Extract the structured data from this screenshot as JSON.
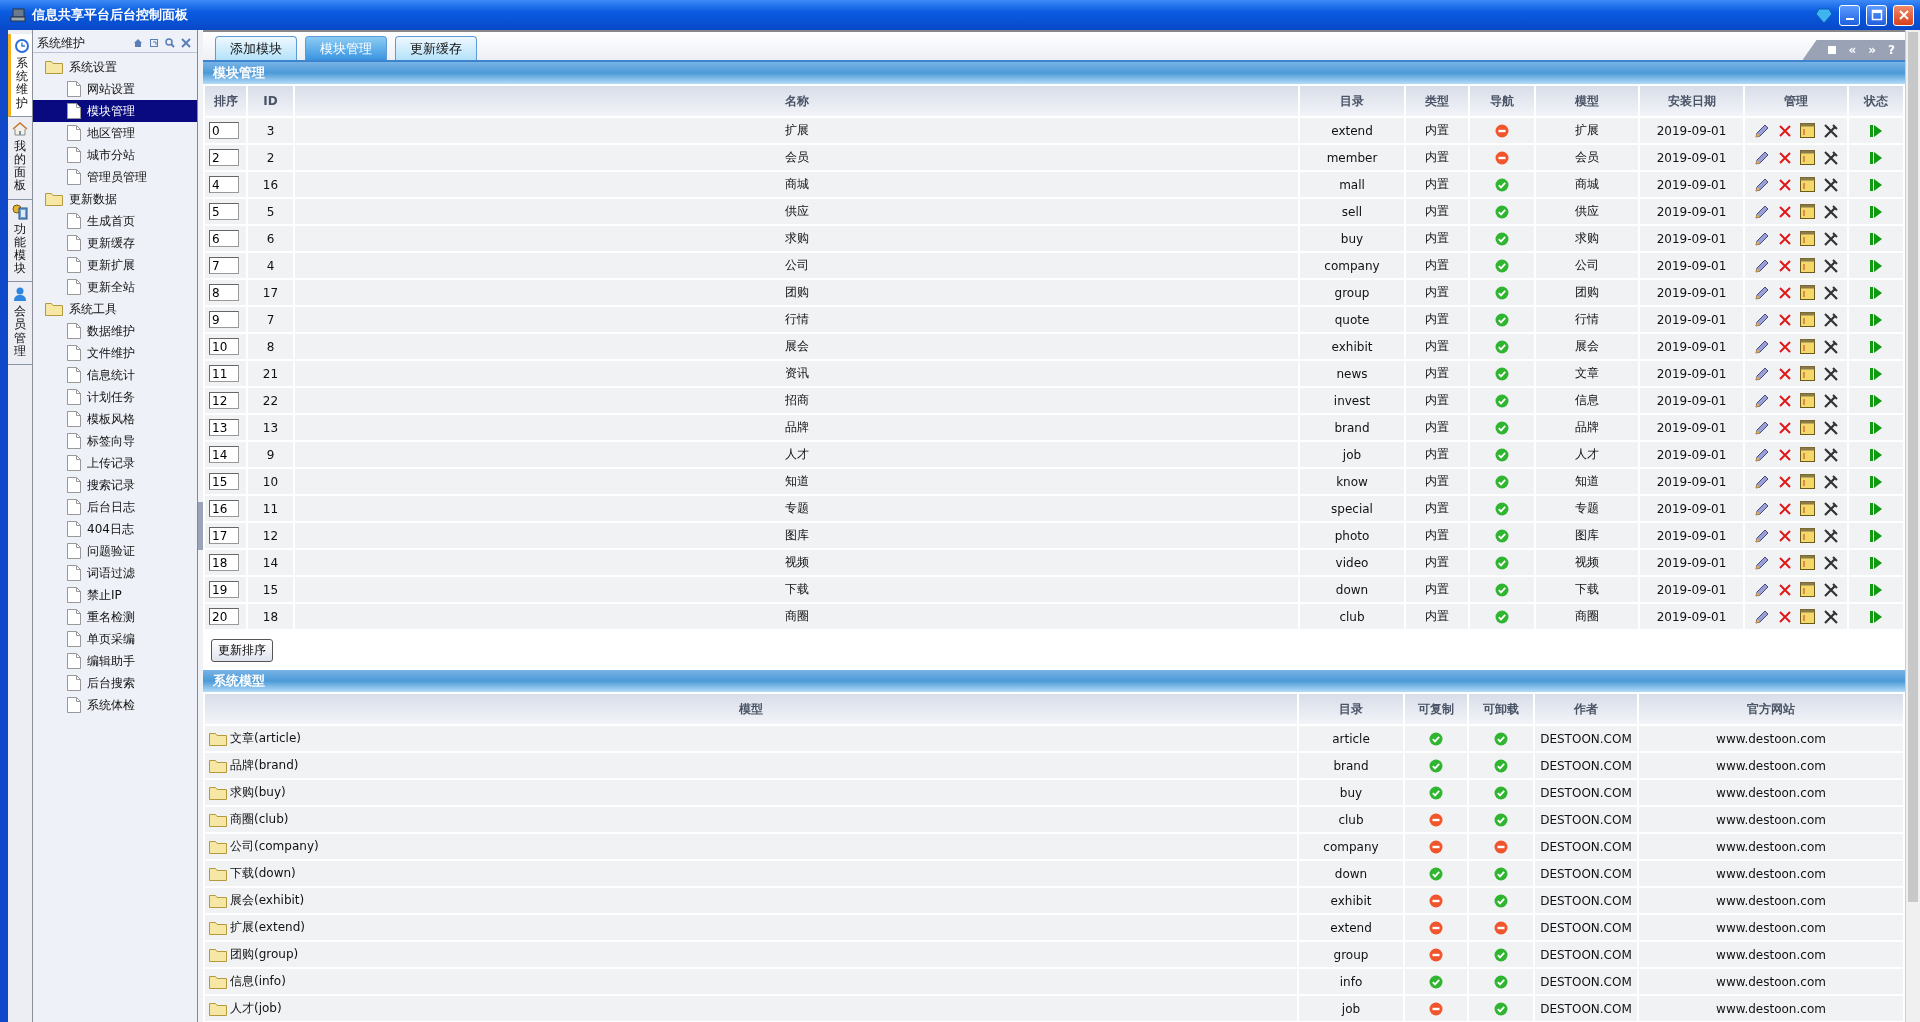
{
  "window": {
    "title": "信息共享平台后台控制面板"
  },
  "side_tabs": [
    {
      "label": "系统维护",
      "selected": true
    },
    {
      "label": "我的面板",
      "selected": false
    },
    {
      "label": "功能模块",
      "selected": false
    },
    {
      "label": "会员管理",
      "selected": false
    }
  ],
  "sidebar": {
    "title": "系统维护",
    "items": [
      {
        "label": "系统设置",
        "children": [
          {
            "label": "网站设置",
            "selected": false
          },
          {
            "label": "模块管理",
            "selected": true
          },
          {
            "label": "地区管理",
            "selected": false
          },
          {
            "label": "城市分站",
            "selected": false
          },
          {
            "label": "管理员管理",
            "selected": false
          }
        ]
      },
      {
        "label": "更新数据",
        "children": [
          {
            "label": "生成首页",
            "selected": false
          },
          {
            "label": "更新缓存",
            "selected": false
          },
          {
            "label": "更新扩展",
            "selected": false
          },
          {
            "label": "更新全站",
            "selected": false
          }
        ]
      },
      {
        "label": "系统工具",
        "children": [
          {
            "label": "数据维护",
            "selected": false
          },
          {
            "label": "文件维护",
            "selected": false
          },
          {
            "label": "信息统计",
            "selected": false
          },
          {
            "label": "计划任务",
            "selected": false
          },
          {
            "label": "模板风格",
            "selected": false
          },
          {
            "label": "标签向导",
            "selected": false
          },
          {
            "label": "上传记录",
            "selected": false
          },
          {
            "label": "搜索记录",
            "selected": false
          },
          {
            "label": "后台日志",
            "selected": false
          },
          {
            "label": "404日志",
            "selected": false
          },
          {
            "label": "问题验证",
            "selected": false
          },
          {
            "label": "词语过滤",
            "selected": false
          },
          {
            "label": "禁止IP",
            "selected": false
          },
          {
            "label": "重名检测",
            "selected": false
          },
          {
            "label": "单页采编",
            "selected": false
          },
          {
            "label": "编辑助手",
            "selected": false
          },
          {
            "label": "后台搜索",
            "selected": false
          },
          {
            "label": "系统体检",
            "selected": false
          }
        ]
      }
    ]
  },
  "tabs": [
    {
      "label": "添加模块",
      "selected": false
    },
    {
      "label": "模块管理",
      "selected": true
    },
    {
      "label": "更新缓存",
      "selected": false
    }
  ],
  "corner_buttons": [
    "«",
    "»",
    "?"
  ],
  "modules": {
    "title": "模块管理",
    "columns": [
      "排序",
      "ID",
      "名称",
      "目录",
      "类型",
      "导航",
      "模型",
      "安装日期",
      "管理",
      "状态"
    ],
    "rows": [
      {
        "order": "0",
        "id": "3",
        "name": "扩展",
        "dir": "extend",
        "type": "内置",
        "nav": false,
        "model": "扩展",
        "date": "2019-09-01",
        "enabled": true
      },
      {
        "order": "2",
        "id": "2",
        "name": "会员",
        "dir": "member",
        "type": "内置",
        "nav": false,
        "model": "会员",
        "date": "2019-09-01",
        "enabled": true
      },
      {
        "order": "4",
        "id": "16",
        "name": "商城",
        "dir": "mall",
        "type": "内置",
        "nav": true,
        "model": "商城",
        "date": "2019-09-01",
        "enabled": true
      },
      {
        "order": "5",
        "id": "5",
        "name": "供应",
        "dir": "sell",
        "type": "内置",
        "nav": true,
        "model": "供应",
        "date": "2019-09-01",
        "enabled": true
      },
      {
        "order": "6",
        "id": "6",
        "name": "求购",
        "dir": "buy",
        "type": "内置",
        "nav": true,
        "model": "求购",
        "date": "2019-09-01",
        "enabled": true
      },
      {
        "order": "7",
        "id": "4",
        "name": "公司",
        "dir": "company",
        "type": "内置",
        "nav": true,
        "model": "公司",
        "date": "2019-09-01",
        "enabled": true
      },
      {
        "order": "8",
        "id": "17",
        "name": "团购",
        "dir": "group",
        "type": "内置",
        "nav": true,
        "model": "团购",
        "date": "2019-09-01",
        "enabled": true
      },
      {
        "order": "9",
        "id": "7",
        "name": "行情",
        "dir": "quote",
        "type": "内置",
        "nav": true,
        "model": "行情",
        "date": "2019-09-01",
        "enabled": true
      },
      {
        "order": "10",
        "id": "8",
        "name": "展会",
        "dir": "exhibit",
        "type": "内置",
        "nav": true,
        "model": "展会",
        "date": "2019-09-01",
        "enabled": true
      },
      {
        "order": "11",
        "id": "21",
        "name": "资讯",
        "dir": "news",
        "type": "内置",
        "nav": true,
        "model": "文章",
        "date": "2019-09-01",
        "enabled": true
      },
      {
        "order": "12",
        "id": "22",
        "name": "招商",
        "dir": "invest",
        "type": "内置",
        "nav": true,
        "model": "信息",
        "date": "2019-09-01",
        "enabled": true
      },
      {
        "order": "13",
        "id": "13",
        "name": "品牌",
        "dir": "brand",
        "type": "内置",
        "nav": true,
        "model": "品牌",
        "date": "2019-09-01",
        "enabled": true
      },
      {
        "order": "14",
        "id": "9",
        "name": "人才",
        "dir": "job",
        "type": "内置",
        "nav": true,
        "model": "人才",
        "date": "2019-09-01",
        "enabled": true
      },
      {
        "order": "15",
        "id": "10",
        "name": "知道",
        "dir": "know",
        "type": "内置",
        "nav": true,
        "model": "知道",
        "date": "2019-09-01",
        "enabled": true
      },
      {
        "order": "16",
        "id": "11",
        "name": "专题",
        "dir": "special",
        "type": "内置",
        "nav": true,
        "model": "专题",
        "date": "2019-09-01",
        "enabled": true
      },
      {
        "order": "17",
        "id": "12",
        "name": "图库",
        "dir": "photo",
        "type": "内置",
        "nav": true,
        "model": "图库",
        "date": "2019-09-01",
        "enabled": true
      },
      {
        "order": "18",
        "id": "14",
        "name": "视频",
        "dir": "video",
        "type": "内置",
        "nav": true,
        "model": "视频",
        "date": "2019-09-01",
        "enabled": true
      },
      {
        "order": "19",
        "id": "15",
        "name": "下载",
        "dir": "down",
        "type": "内置",
        "nav": true,
        "model": "下载",
        "date": "2019-09-01",
        "enabled": true
      },
      {
        "order": "20",
        "id": "18",
        "name": "商圈",
        "dir": "club",
        "type": "内置",
        "nav": true,
        "model": "商圈",
        "date": "2019-09-01",
        "enabled": true
      }
    ],
    "button": "更新排序"
  },
  "models": {
    "title": "系统模型",
    "columns": [
      "模型",
      "目录",
      "可复制",
      "可卸载",
      "作者",
      "官方网站"
    ],
    "rows": [
      {
        "name": "文章(article)",
        "dir": "article",
        "copyable": true,
        "uninstallable": true,
        "author": "DESTOON.COM",
        "site": "www.destoon.com"
      },
      {
        "name": "品牌(brand)",
        "dir": "brand",
        "copyable": true,
        "uninstallable": true,
        "author": "DESTOON.COM",
        "site": "www.destoon.com"
      },
      {
        "name": "求购(buy)",
        "dir": "buy",
        "copyable": true,
        "uninstallable": true,
        "author": "DESTOON.COM",
        "site": "www.destoon.com"
      },
      {
        "name": "商圈(club)",
        "dir": "club",
        "copyable": false,
        "uninstallable": true,
        "author": "DESTOON.COM",
        "site": "www.destoon.com"
      },
      {
        "name": "公司(company)",
        "dir": "company",
        "copyable": false,
        "uninstallable": false,
        "author": "DESTOON.COM",
        "site": "www.destoon.com"
      },
      {
        "name": "下载(down)",
        "dir": "down",
        "copyable": true,
        "uninstallable": true,
        "author": "DESTOON.COM",
        "site": "www.destoon.com"
      },
      {
        "name": "展会(exhibit)",
        "dir": "exhibit",
        "copyable": false,
        "uninstallable": true,
        "author": "DESTOON.COM",
        "site": "www.destoon.com"
      },
      {
        "name": "扩展(extend)",
        "dir": "extend",
        "copyable": false,
        "uninstallable": false,
        "author": "DESTOON.COM",
        "site": "www.destoon.com"
      },
      {
        "name": "团购(group)",
        "dir": "group",
        "copyable": false,
        "uninstallable": true,
        "author": "DESTOON.COM",
        "site": "www.destoon.com"
      },
      {
        "name": "信息(info)",
        "dir": "info",
        "copyable": true,
        "uninstallable": true,
        "author": "DESTOON.COM",
        "site": "www.destoon.com"
      },
      {
        "name": "人才(job)",
        "dir": "job",
        "copyable": false,
        "uninstallable": true,
        "author": "DESTOON.COM",
        "site": "www.destoon.com"
      }
    ]
  }
}
